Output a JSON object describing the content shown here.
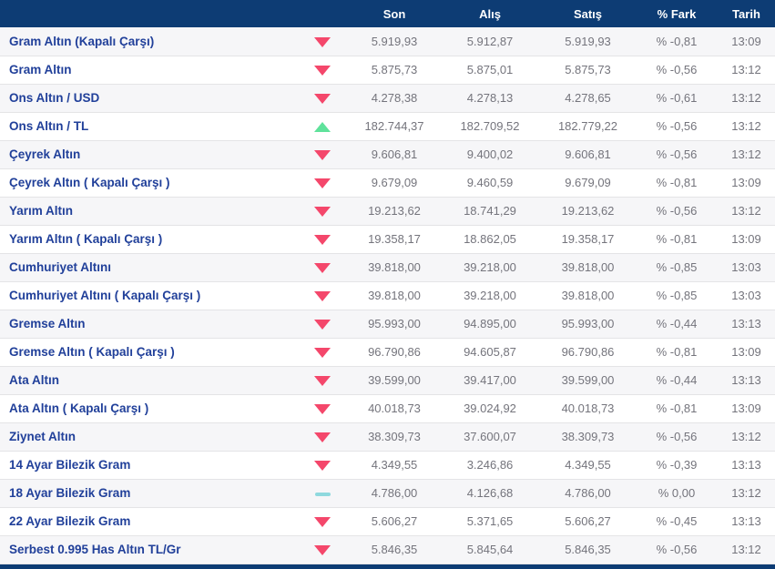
{
  "table": {
    "columns": [
      "Son",
      "Alış",
      "Satış",
      "% Fark",
      "Tarih"
    ],
    "rows": [
      {
        "name": "Gram Altın (Kapalı Çarşı)",
        "direction": "down",
        "son": "5.919,93",
        "alis": "5.912,87",
        "satis": "5.919,93",
        "fark": "% -0,81",
        "tarih": "13:09"
      },
      {
        "name": "Gram Altın",
        "direction": "down",
        "son": "5.875,73",
        "alis": "5.875,01",
        "satis": "5.875,73",
        "fark": "% -0,56",
        "tarih": "13:12"
      },
      {
        "name": "Ons Altın / USD",
        "direction": "down",
        "son": "4.278,38",
        "alis": "4.278,13",
        "satis": "4.278,65",
        "fark": "% -0,61",
        "tarih": "13:12"
      },
      {
        "name": "Ons Altın / TL",
        "direction": "up",
        "son": "182.744,37",
        "alis": "182.709,52",
        "satis": "182.779,22",
        "fark": "% -0,56",
        "tarih": "13:12"
      },
      {
        "name": "Çeyrek Altın",
        "direction": "down",
        "son": "9.606,81",
        "alis": "9.400,02",
        "satis": "9.606,81",
        "fark": "% -0,56",
        "tarih": "13:12"
      },
      {
        "name": "Çeyrek Altın ( Kapalı Çarşı )",
        "direction": "down",
        "son": "9.679,09",
        "alis": "9.460,59",
        "satis": "9.679,09",
        "fark": "% -0,81",
        "tarih": "13:09"
      },
      {
        "name": "Yarım Altın",
        "direction": "down",
        "son": "19.213,62",
        "alis": "18.741,29",
        "satis": "19.213,62",
        "fark": "% -0,56",
        "tarih": "13:12"
      },
      {
        "name": "Yarım Altın ( Kapalı Çarşı )",
        "direction": "down",
        "son": "19.358,17",
        "alis": "18.862,05",
        "satis": "19.358,17",
        "fark": "% -0,81",
        "tarih": "13:09"
      },
      {
        "name": "Cumhuriyet Altını",
        "direction": "down",
        "son": "39.818,00",
        "alis": "39.218,00",
        "satis": "39.818,00",
        "fark": "% -0,85",
        "tarih": "13:03"
      },
      {
        "name": "Cumhuriyet Altını ( Kapalı Çarşı )",
        "direction": "down",
        "son": "39.818,00",
        "alis": "39.218,00",
        "satis": "39.818,00",
        "fark": "% -0,85",
        "tarih": "13:03"
      },
      {
        "name": "Gremse Altın",
        "direction": "down",
        "son": "95.993,00",
        "alis": "94.895,00",
        "satis": "95.993,00",
        "fark": "% -0,44",
        "tarih": "13:13"
      },
      {
        "name": "Gremse Altın ( Kapalı Çarşı )",
        "direction": "down",
        "son": "96.790,86",
        "alis": "94.605,87",
        "satis": "96.790,86",
        "fark": "% -0,81",
        "tarih": "13:09"
      },
      {
        "name": "Ata Altın",
        "direction": "down",
        "son": "39.599,00",
        "alis": "39.417,00",
        "satis": "39.599,00",
        "fark": "% -0,44",
        "tarih": "13:13"
      },
      {
        "name": "Ata Altın ( Kapalı Çarşı )",
        "direction": "down",
        "son": "40.018,73",
        "alis": "39.024,92",
        "satis": "40.018,73",
        "fark": "% -0,81",
        "tarih": "13:09"
      },
      {
        "name": "Ziynet Altın",
        "direction": "down",
        "son": "38.309,73",
        "alis": "37.600,07",
        "satis": "38.309,73",
        "fark": "% -0,56",
        "tarih": "13:12"
      },
      {
        "name": "14 Ayar Bilezik Gram",
        "direction": "down",
        "son": "4.349,55",
        "alis": "3.246,86",
        "satis": "4.349,55",
        "fark": "% -0,39",
        "tarih": "13:13"
      },
      {
        "name": "18 Ayar Bilezik Gram",
        "direction": "flat",
        "son": "4.786,00",
        "alis": "4.126,68",
        "satis": "4.786,00",
        "fark": "% 0,00",
        "tarih": "13:12"
      },
      {
        "name": "22 Ayar Bilezik Gram",
        "direction": "down",
        "son": "5.606,27",
        "alis": "5.371,65",
        "satis": "5.606,27",
        "fark": "% -0,45",
        "tarih": "13:13"
      },
      {
        "name": "Serbest 0.995 Has Altın TL/Gr",
        "direction": "down",
        "son": "5.846,35",
        "alis": "5.845,64",
        "satis": "5.846,35",
        "fark": "% -0,56",
        "tarih": "13:12"
      }
    ]
  },
  "colors": {
    "header_bg": "#0d3c74",
    "header_text": "#ffffff",
    "name_text": "#21409a",
    "value_text": "#74747c",
    "row_alt_bg": "#f6f6f8",
    "down_arrow": "#f4476b",
    "up_arrow": "#5fe29b",
    "flat_dash": "#8fd9de"
  }
}
